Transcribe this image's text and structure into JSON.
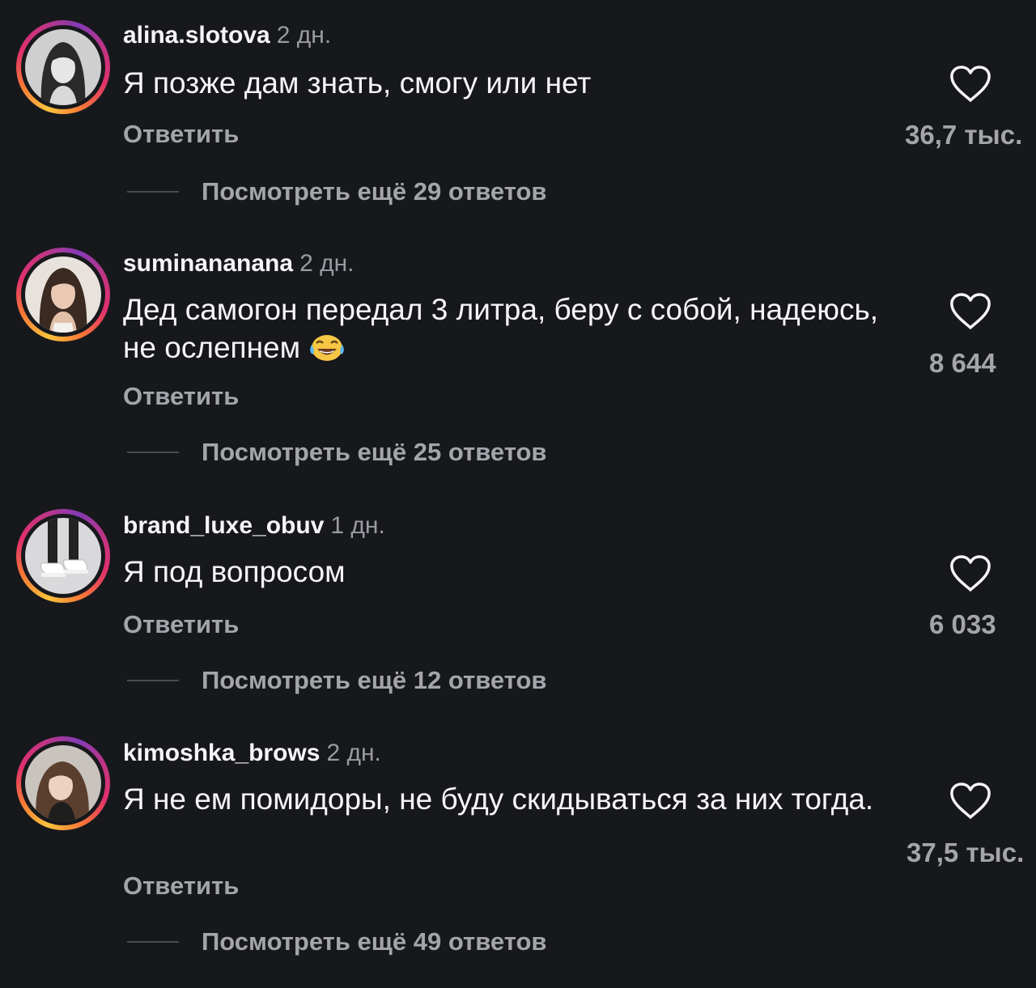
{
  "comments": [
    {
      "username": "alina.slotova",
      "time": "2 дн.",
      "text": "Я позже дам знать, смогу или нет",
      "reply_label": "Ответить",
      "likes": "36,7 тыс.",
      "view_replies": "Посмотреть ещё 29 ответов"
    },
    {
      "username": "suminananana",
      "time": "2 дн.",
      "text": "Дед самогон передал 3 литра, беру с собой, надеюсь, не ослепнем",
      "emoji": "face-with-tears-of-joy",
      "reply_label": "Ответить",
      "likes": "8 644",
      "view_replies": "Посмотреть ещё 25 ответов"
    },
    {
      "username": "brand_luxe_obuv",
      "time": "1 дн.",
      "text": "Я под вопросом",
      "reply_label": "Ответить",
      "likes": "6 033",
      "view_replies": "Посмотреть ещё 12 ответов"
    },
    {
      "username": "kimoshka_brows",
      "time": "2 дн.",
      "text": "Я не ем помидоры, не буду скидываться за них тогда.",
      "reply_label": "Ответить",
      "likes": "37,5 тыс.",
      "view_replies": "Посмотреть ещё 49 ответов"
    }
  ],
  "colors": {
    "background": "#17181c",
    "primary_text": "#f5f5f7",
    "secondary_text": "#a4a5ab",
    "story_ring": [
      "#f9c33c",
      "#f77737",
      "#e1306c",
      "#c13584",
      "#833ab4"
    ]
  },
  "icons": {
    "like": "heart-outline-icon"
  }
}
